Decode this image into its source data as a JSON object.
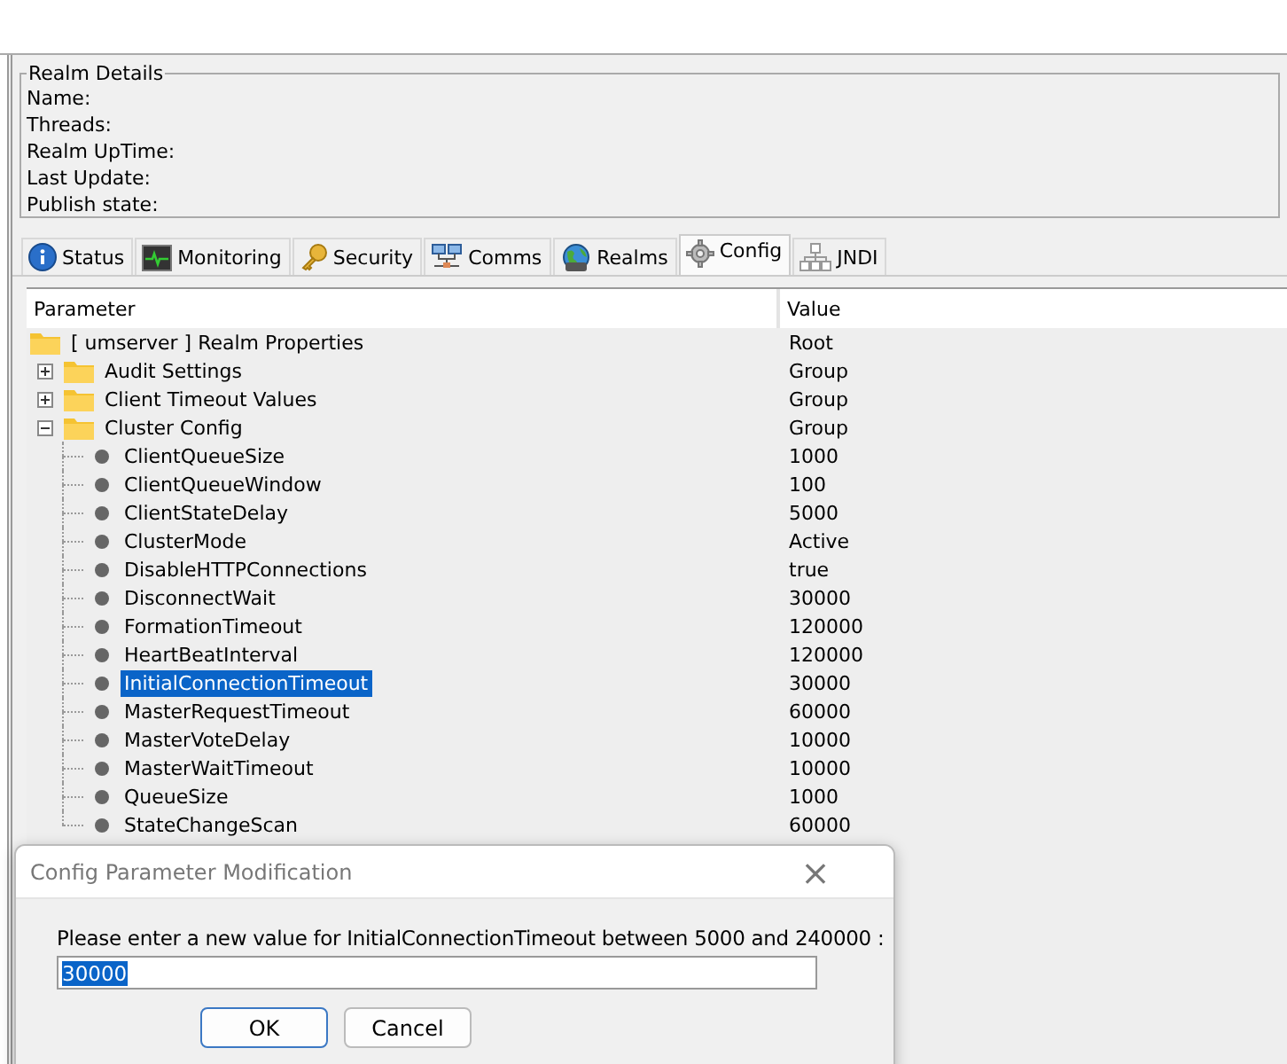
{
  "realm_details": {
    "title": "Realm Details",
    "fields": [
      "Name:",
      "Threads:",
      "Realm UpTime:",
      "Last Update:",
      "Publish state:"
    ]
  },
  "tabs": [
    {
      "label": "Status",
      "selected": false
    },
    {
      "label": "Monitoring",
      "selected": false
    },
    {
      "label": "Security",
      "selected": false
    },
    {
      "label": "Comms",
      "selected": false
    },
    {
      "label": "Realms",
      "selected": false
    },
    {
      "label": "Config",
      "selected": true
    },
    {
      "label": "JNDI",
      "selected": false
    }
  ],
  "table": {
    "columns": [
      "Parameter",
      "Value"
    ],
    "tree": [
      {
        "label": "[ umserver ] Realm Properties",
        "value": "Root",
        "kind": "folder",
        "selected": false,
        "children": [
          {
            "label": "Audit Settings",
            "value": "Group",
            "kind": "folder",
            "expanded": false,
            "selected": false
          },
          {
            "label": "Client Timeout Values",
            "value": "Group",
            "kind": "folder",
            "expanded": false,
            "selected": false
          },
          {
            "label": "Cluster Config",
            "value": "Group",
            "kind": "folder",
            "expanded": true,
            "selected": false,
            "children": [
              {
                "label": "ClientQueueSize",
                "value": "1000",
                "kind": "leaf",
                "selected": false
              },
              {
                "label": "ClientQueueWindow",
                "value": "100",
                "kind": "leaf",
                "selected": false
              },
              {
                "label": "ClientStateDelay",
                "value": "5000",
                "kind": "leaf",
                "selected": false
              },
              {
                "label": "ClusterMode",
                "value": "Active",
                "kind": "leaf",
                "selected": false
              },
              {
                "label": "DisableHTTPConnections",
                "value": "true",
                "kind": "leaf",
                "selected": false
              },
              {
                "label": "DisconnectWait",
                "value": "30000",
                "kind": "leaf",
                "selected": false
              },
              {
                "label": "FormationTimeout",
                "value": "120000",
                "kind": "leaf",
                "selected": false
              },
              {
                "label": "HeartBeatInterval",
                "value": "120000",
                "kind": "leaf",
                "selected": false
              },
              {
                "label": "InitialConnectionTimeout",
                "value": "30000",
                "kind": "leaf",
                "selected": true
              },
              {
                "label": "MasterRequestTimeout",
                "value": "60000",
                "kind": "leaf",
                "selected": false
              },
              {
                "label": "MasterVoteDelay",
                "value": "10000",
                "kind": "leaf",
                "selected": false
              },
              {
                "label": "MasterWaitTimeout",
                "value": "10000",
                "kind": "leaf",
                "selected": false
              },
              {
                "label": "QueueSize",
                "value": "1000",
                "kind": "leaf",
                "selected": false
              },
              {
                "label": "StateChangeScan",
                "value": "60000",
                "kind": "leaf",
                "selected": false
              }
            ]
          }
        ]
      }
    ]
  },
  "dialog": {
    "title": "Config Parameter Modification",
    "close": "×",
    "message": "Please enter a new value for InitialConnectionTimeout between 5000 and 240000 :",
    "value": "30000",
    "value_selected": true,
    "buttons": [
      {
        "label": "OK",
        "default": true
      },
      {
        "label": "Cancel",
        "default": false
      }
    ]
  }
}
